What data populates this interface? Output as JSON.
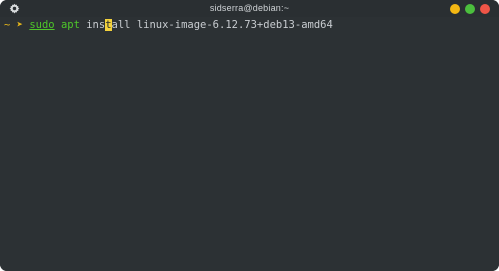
{
  "window": {
    "title": "sidserra@debian:~",
    "controls": {
      "minimize_color": "#f4b813",
      "maximize_color": "#4bbf3d",
      "close_color": "#ef5547"
    }
  },
  "terminal": {
    "prompt_dir": "~",
    "prompt_arrow": "➤",
    "command": "sudo",
    "subcommand": "apt",
    "action_before_cursor": "ins",
    "cursor_char": "t",
    "action_after_cursor": "all",
    "argument": "linux-image-6.12.73+deb13-amd64"
  },
  "icons": {
    "settings": "gear-icon"
  }
}
